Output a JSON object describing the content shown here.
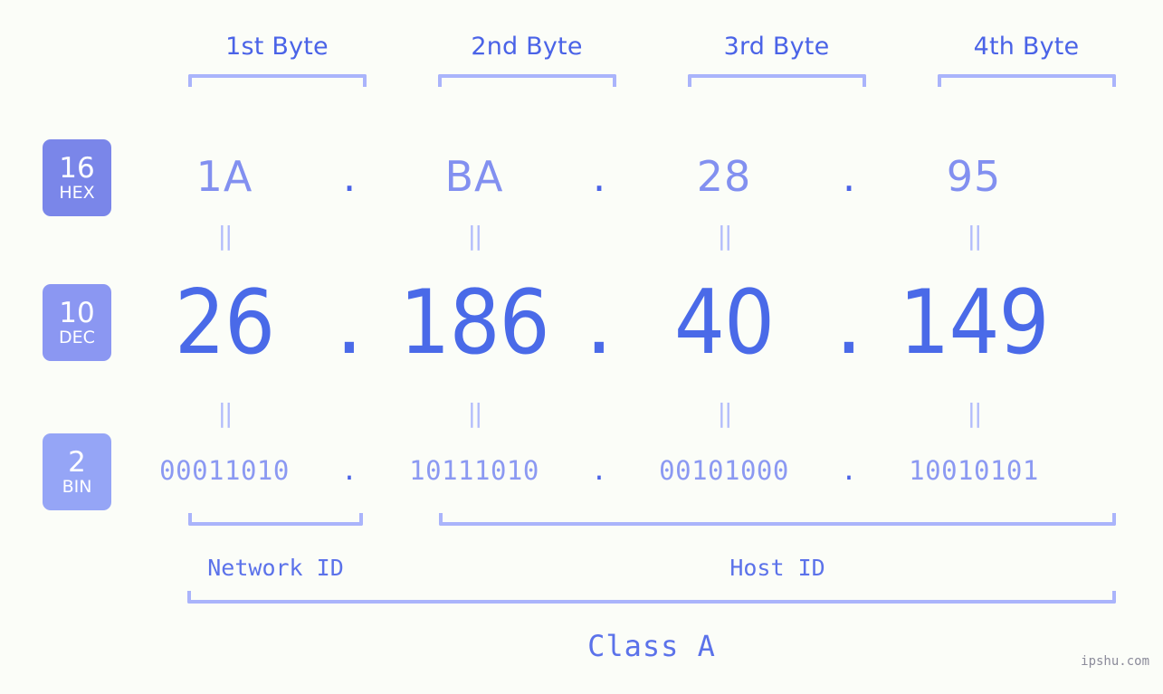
{
  "background_color": "#fbfdf8",
  "colors": {
    "header_blue": "#4a63e7",
    "hex_value": "#8290f0",
    "dec_value": "#4a6ae8",
    "bin_value": "#8b99f2",
    "bracket": "#aab4fb",
    "equals": "#b2bcfb",
    "badge_hex": "#7a86e9",
    "badge_dec": "#8b97f2",
    "badge_bin": "#95a5f6",
    "watermark": "#8b8b9a"
  },
  "byte_headers": [
    {
      "label": "1st Byte"
    },
    {
      "label": "2nd Byte"
    },
    {
      "label": "3rd Byte"
    },
    {
      "label": "4th Byte"
    }
  ],
  "bases": [
    {
      "number": "16",
      "name": "HEX"
    },
    {
      "number": "10",
      "name": "DEC"
    },
    {
      "number": "2",
      "name": "BIN"
    }
  ],
  "separator": ".",
  "equals_glyph": "||",
  "rows": {
    "hex": {
      "values": [
        "1A",
        "BA",
        "28",
        "95"
      ]
    },
    "dec": {
      "values": [
        "26",
        "186",
        "40",
        "149"
      ]
    },
    "bin": {
      "values": [
        "00011010",
        "10111010",
        "00101000",
        "10010101"
      ]
    }
  },
  "segments": {
    "network_id": "Network ID",
    "host_id": "Host ID",
    "class": "Class A"
  },
  "watermark": "ipshu.com"
}
